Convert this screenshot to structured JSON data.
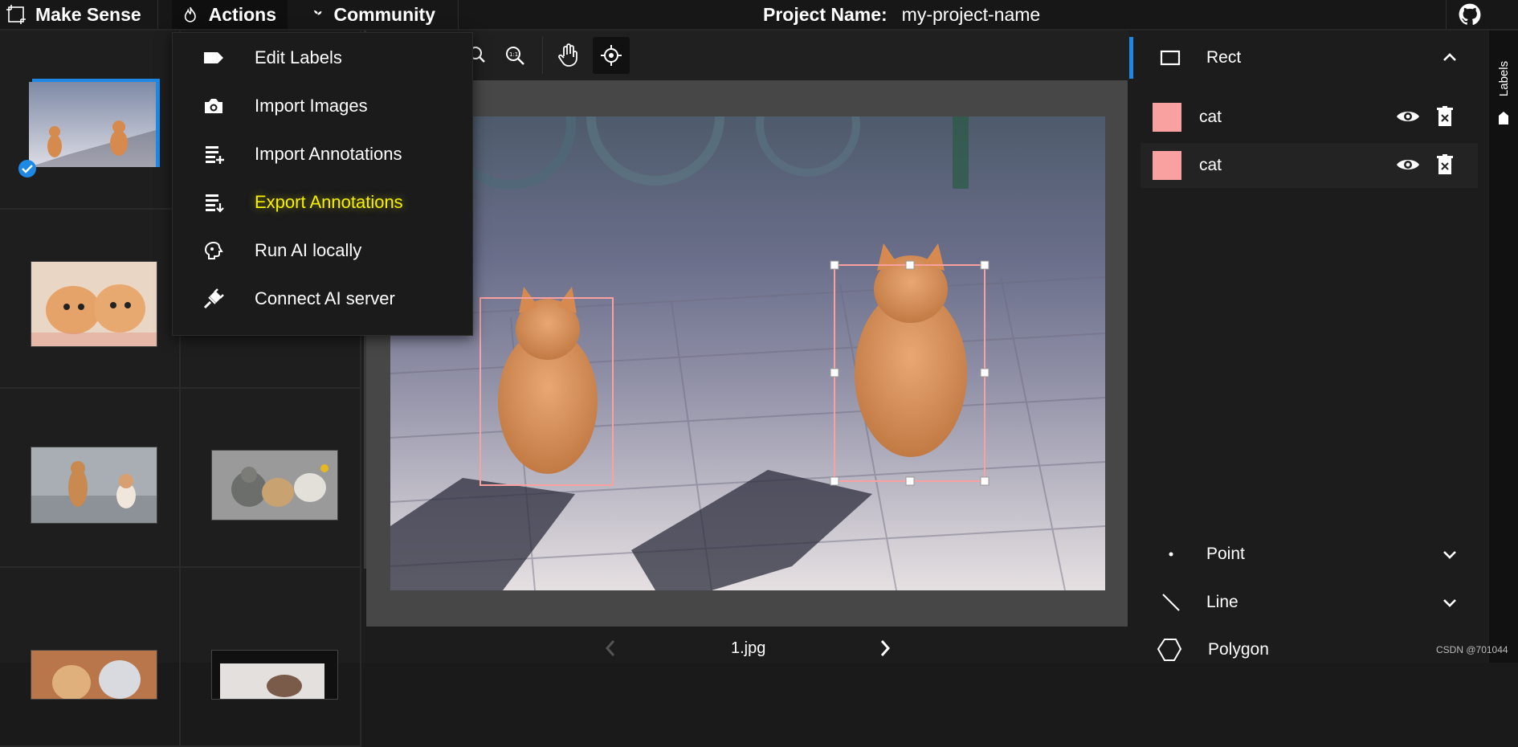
{
  "app": {
    "name": "Make Sense"
  },
  "topbar": {
    "actions_label": "Actions",
    "community_label": "Community",
    "project_label": "Project Name:",
    "project_value": "my-project-name"
  },
  "menu": {
    "items": [
      {
        "label": "Edit Labels",
        "icon": "tag-icon"
      },
      {
        "label": "Import Images",
        "icon": "camera-icon"
      },
      {
        "label": "Import Annotations",
        "icon": "list-add-icon"
      },
      {
        "label": "Export Annotations",
        "icon": "list-download-icon",
        "highlighted": true
      },
      {
        "label": "Run AI locally",
        "icon": "brain-icon"
      },
      {
        "label": "Connect AI server",
        "icon": "plug-icon"
      }
    ]
  },
  "editor": {
    "filename": "1.jpg",
    "tools": [
      "zoom-in-icon",
      "zoom-fit-icon",
      "hand-icon",
      "crosshair-icon"
    ]
  },
  "right_panel": {
    "rect": {
      "title": "Rect",
      "labels": [
        {
          "name": "cat"
        },
        {
          "name": "cat"
        }
      ]
    },
    "point": {
      "title": "Point"
    },
    "line": {
      "title": "Line"
    },
    "polygon": {
      "title": "Polygon"
    },
    "side_tab": "Labels"
  },
  "colors": {
    "accent": "#1e88e5",
    "label_swatch": "#f8a1a0",
    "highlight": "#f7f100"
  },
  "watermark": "CSDN @701044"
}
